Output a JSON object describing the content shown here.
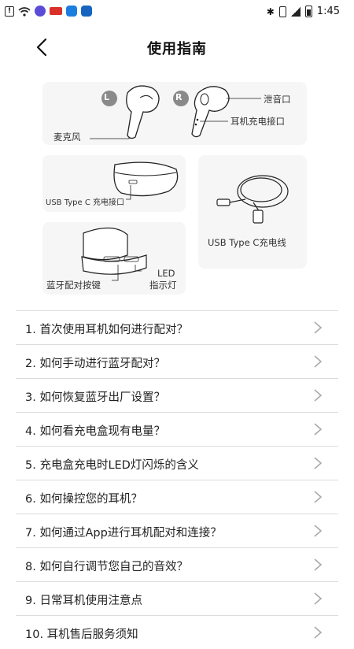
{
  "status_bar": {
    "time": "1:45"
  },
  "header": {
    "title": "使用指南"
  },
  "illustrations": {
    "earbuds": {
      "left_badge": "L",
      "right_badge": "R",
      "vent": "泄音口",
      "charge_port": "耳机充电接口",
      "mic": "麦克风"
    },
    "case": {
      "usb_port": "USB Type C 充电接口"
    },
    "cable": {
      "label": "USB Type C充电线"
    },
    "case_open": {
      "pair_button": "蓝牙配对按键",
      "led_line1": "LED",
      "led_line2": "指示灯"
    }
  },
  "faq": [
    "1. 首次使用耳机如何进行配对？",
    "2. 如何手动进行蓝牙配对？",
    "3. 如何恢复蓝牙出厂设置？",
    "4. 如何看充电盒现有电量？",
    "5. 充电盒充电时LED灯闪烁的含义",
    "6. 如何操控您的耳机？",
    "7. 如何通过App进行耳机配对和连接？",
    "8. 如何自行调节您自己的音效？",
    "9. 日常耳机使用注意点",
    "10. 耳机售后服务须知"
  ]
}
